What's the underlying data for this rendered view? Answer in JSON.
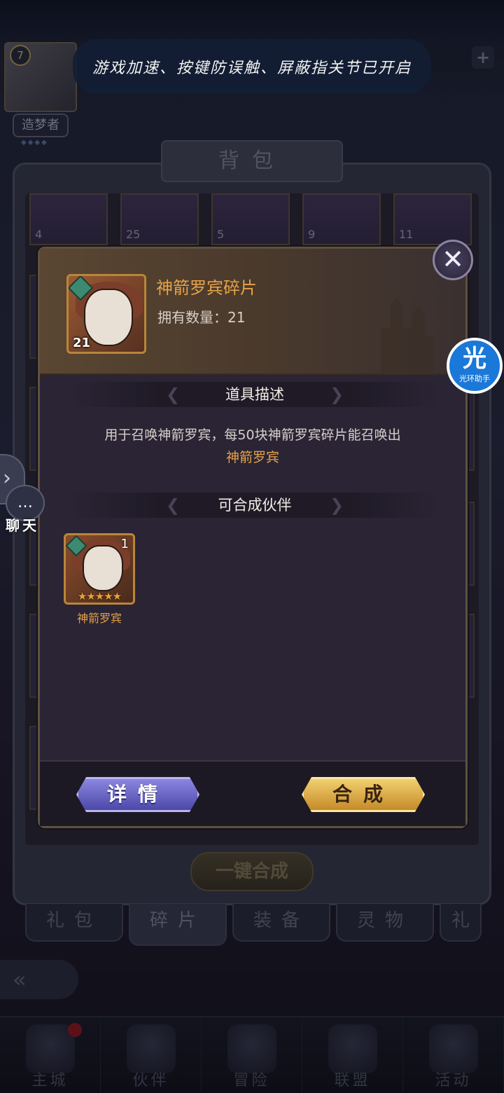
{
  "banner": {
    "text": "游戏加速、按键防误触、屏蔽指关节已开启"
  },
  "player": {
    "level": "7",
    "rank": "造梦者",
    "rank_dots": "◆◆◆◆"
  },
  "bag": {
    "title": "背包",
    "card_counts": [
      "4",
      "25",
      "5",
      "9",
      "11"
    ],
    "merge_all_label": "一键合成"
  },
  "tabs": [
    "礼包",
    "碎片",
    "装备",
    "灵物",
    "礼"
  ],
  "active_tab": "碎片",
  "bottom_nav": [
    {
      "label": "主城",
      "has_badge": true
    },
    {
      "label": "伙伴"
    },
    {
      "label": "冒险"
    },
    {
      "label": "联盟"
    },
    {
      "label": "活动"
    }
  ],
  "modal": {
    "item_name": "神箭罗宾碎片",
    "owned_label": "拥有数量：21",
    "item_count": "21",
    "section_desc_title": "道具描述",
    "description": "用于召唤神箭罗宾，每50块神箭罗宾碎片能召唤出",
    "description_highlight": "神箭罗宾",
    "section_partner_title": "可合成伙伴",
    "partner": {
      "name": "神箭罗宾",
      "count": "1",
      "stars": "★★★★★"
    },
    "detail_button": "详情",
    "combine_button": "合成"
  },
  "assistant": {
    "glyph": "光",
    "label": "光环助手"
  },
  "chat": {
    "label": "聊天"
  },
  "colors": {
    "accent_gold": "#e5a24a",
    "detail_purple": "#6e6ac8",
    "combine_gold": "#e0b04c",
    "assist_blue": "#1a78d8"
  },
  "icons": [
    "close-icon",
    "chevron-right-icon",
    "chat-icon",
    "back-arrow-icon"
  ]
}
